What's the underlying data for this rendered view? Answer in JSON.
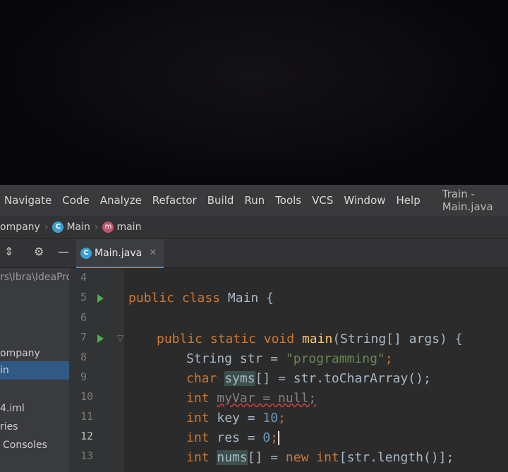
{
  "menu": {
    "items": [
      "Navigate",
      "Code",
      "Analyze",
      "Refactor",
      "Build",
      "Run",
      "Tools",
      "VCS",
      "Window",
      "Help"
    ],
    "title": "Train - Main.java"
  },
  "breadcrumb": {
    "project": "ompany",
    "class": "Main",
    "method": "main"
  },
  "editor_tab": {
    "label": "Main.java"
  },
  "sidebar": {
    "path": "rs\\Ibra\\IdeaPro",
    "items": [
      "ompany",
      "in",
      "4.iml",
      "ries",
      "Consoles"
    ],
    "selected_index": 1
  },
  "gutter": {
    "line_numbers": [
      "4",
      "5",
      "6",
      "7",
      "8",
      "9",
      "10",
      "11",
      "12",
      "13"
    ],
    "current_line": "12"
  },
  "code": {
    "l5": [
      "public",
      " ",
      "class",
      " Main {"
    ],
    "l7": [
      "public",
      " ",
      "static",
      " ",
      "void",
      " ",
      "main",
      "(String[] args) {"
    ],
    "l8": [
      "String str = ",
      "\"programming\"",
      ";"
    ],
    "l9": [
      "char",
      " ",
      "syms",
      "[] = str.toCharArray();"
    ],
    "l10": [
      "int",
      " ",
      "myVar = null;"
    ],
    "l11": [
      "int",
      " key = ",
      "10",
      ";"
    ],
    "l12": [
      "int",
      " res = ",
      "0",
      ";"
    ],
    "l13": [
      "int",
      " ",
      "nums",
      "[] = ",
      "new",
      " ",
      "int",
      "[str.length()];"
    ]
  },
  "colors": {
    "keyword": "#cc7832",
    "string": "#6a8759",
    "number": "#6897bb",
    "method": "#ffc66d",
    "text": "#a9b7c6",
    "background": "#2b2b2b",
    "tab_accent": "#4a8fd3"
  }
}
